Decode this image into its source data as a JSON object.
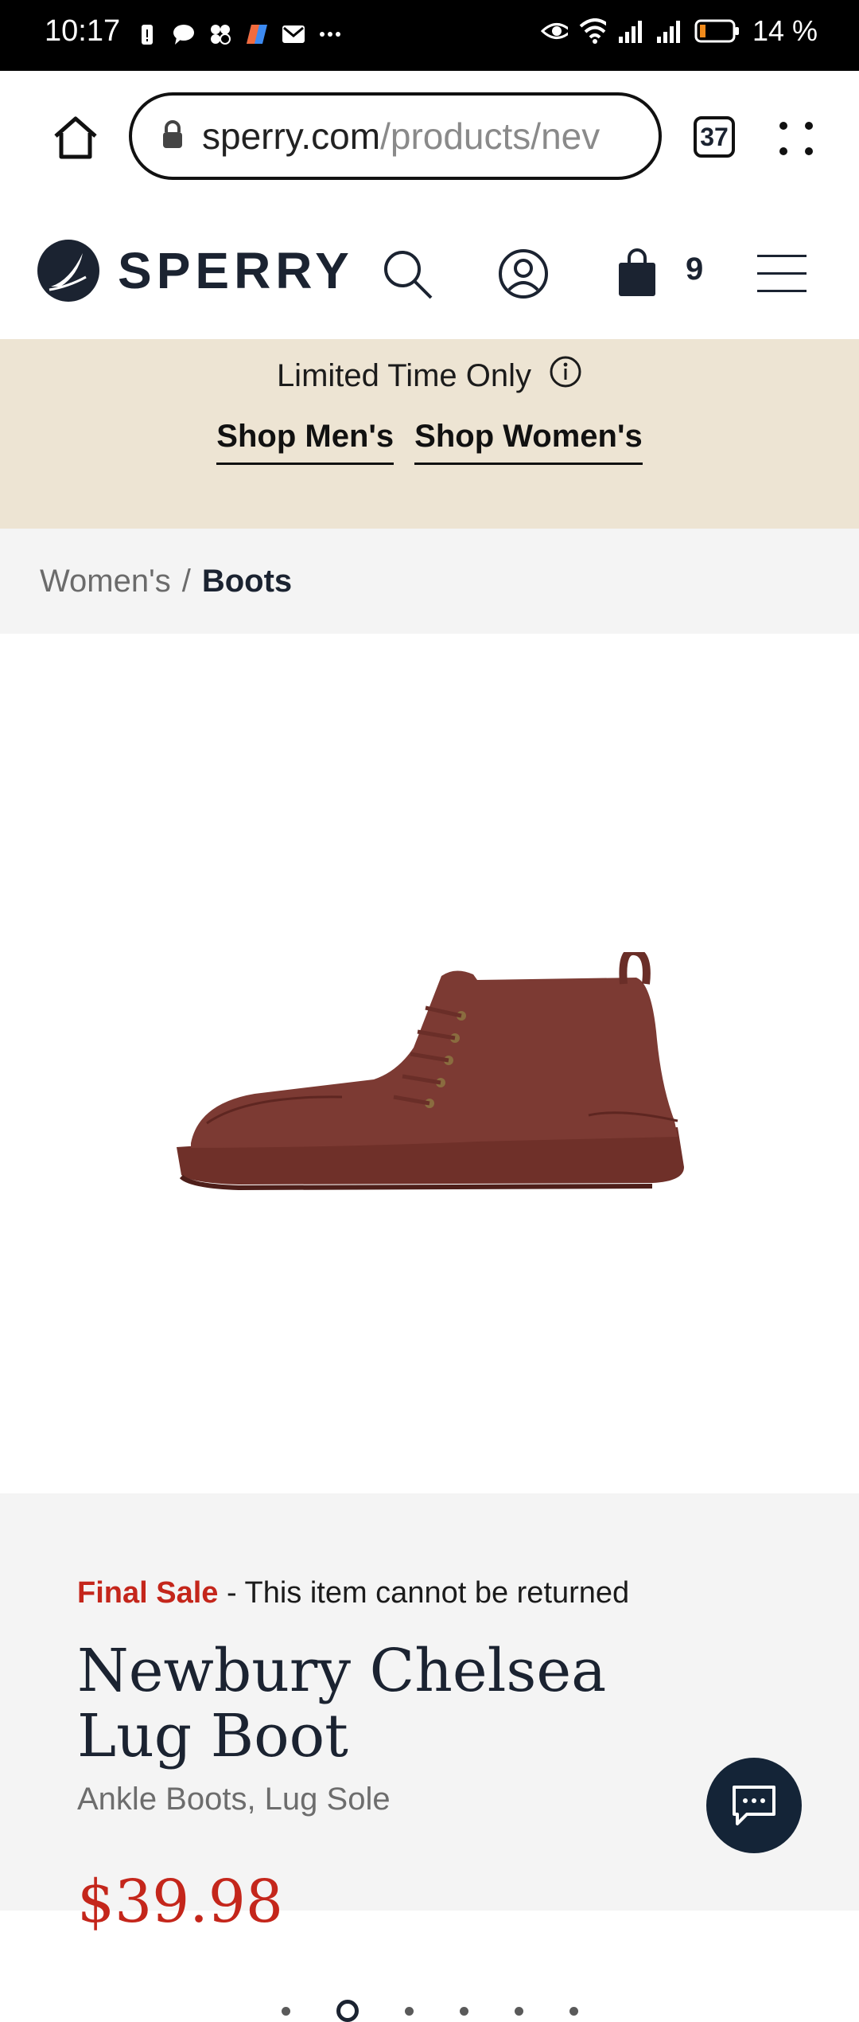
{
  "status_bar": {
    "time": "10:17",
    "battery": "14 %"
  },
  "browser": {
    "url_host": "sperry.com",
    "url_path": "/products/nev",
    "tab_count": "37"
  },
  "header": {
    "brand": "SPERRY",
    "cart_count": "9"
  },
  "promo": {
    "title": "Limited Time Only",
    "links": [
      "Shop Men's",
      "Shop Women's"
    ]
  },
  "breadcrumb": {
    "parent": "Women's",
    "separator": "/",
    "current": "Boots"
  },
  "gallery": {
    "active_index": 1,
    "total": 6
  },
  "product": {
    "final_sale": "Final Sale",
    "final_sale_note": " - This item cannot be returned",
    "title": "Newbury Chelsea Lug Boot",
    "subtitle": "Ankle Boots, Lug Sole",
    "price": "$39.98"
  },
  "colors": {
    "accent_red": "#c4261b",
    "brand_navy": "#1b2331",
    "promo_bg": "#ede4d3",
    "boot": "#7c3a33"
  }
}
